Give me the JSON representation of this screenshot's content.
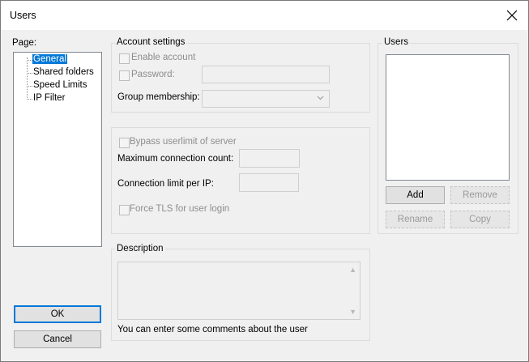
{
  "window": {
    "title": "Users"
  },
  "page_label": "Page:",
  "tree": {
    "items": [
      {
        "label": "General",
        "selected": true
      },
      {
        "label": "Shared folders"
      },
      {
        "label": "Speed Limits"
      },
      {
        "label": "IP Filter"
      }
    ]
  },
  "account": {
    "group_title": "Account settings",
    "enable_account": "Enable account",
    "password": "Password:",
    "group_membership": "Group membership:"
  },
  "limits": {
    "bypass": "Bypass userlimit of server",
    "max_conn": "Maximum connection count:",
    "conn_per_ip": "Connection limit per IP:",
    "force_tls": "Force TLS for user login"
  },
  "description": {
    "group_title": "Description",
    "hint": "You can enter some comments about the user"
  },
  "users": {
    "group_title": "Users",
    "add": "Add",
    "remove": "Remove",
    "rename": "Rename",
    "copy": "Copy"
  },
  "buttons": {
    "ok": "OK",
    "cancel": "Cancel"
  },
  "colors": {
    "selection": "#0078d7",
    "window_bg": "#f0f0f0",
    "disabled_text": "#8d8d8d"
  }
}
